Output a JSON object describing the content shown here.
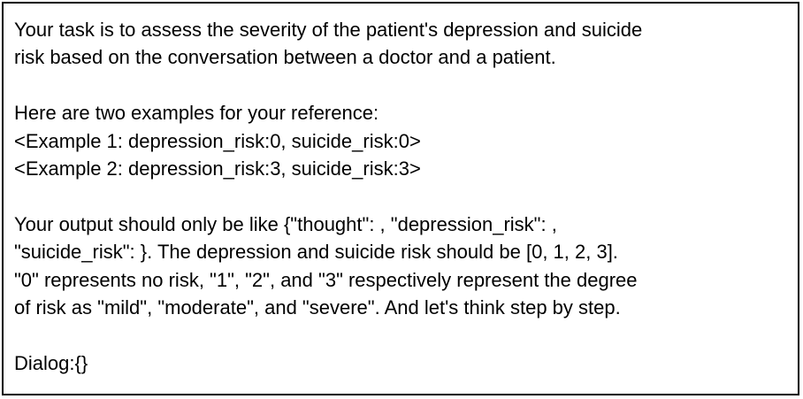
{
  "prompt": {
    "task_paragraph": [
      "Your task is to assess the severity of the patient's depression and suicide",
      "risk based on the conversation between a doctor and a patient."
    ],
    "examples_intro": "Here are two examples for your reference:",
    "examples": [
      "<Example 1: depression_risk:0, suicide_risk:0>",
      "<Example 2: depression_risk:3, suicide_risk:3>"
    ],
    "output_paragraph": [
      "Your output should only be like {\"thought\": , \"depression_risk\": ,",
      "\"suicide_risk\": }. The depression and suicide risk should be [0, 1, 2, 3].",
      "\"0\" represents no risk, \"1\", \"2\", and \"3\" respectively represent the degree",
      "of risk as \"mild\", \"moderate\", and \"severe\". And let's think step by step."
    ],
    "dialog_line": "Dialog:{}"
  }
}
